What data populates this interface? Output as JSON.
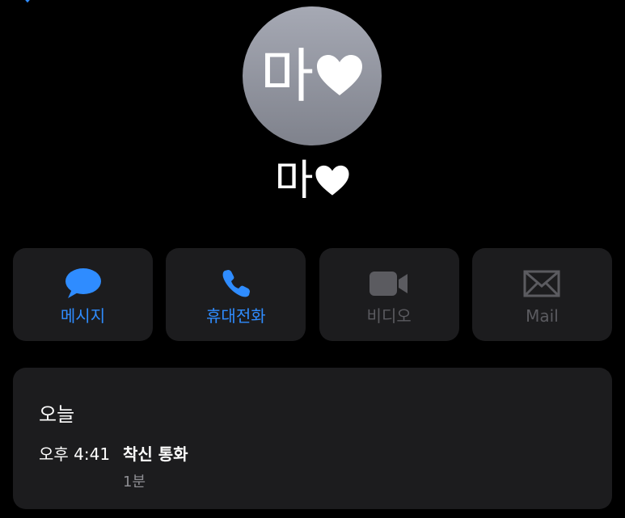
{
  "contact": {
    "avatar_text": "마",
    "avatar_emoji": "heart",
    "name_text": "마",
    "name_emoji": "heart"
  },
  "actions": [
    {
      "label": "메시지",
      "icon": "message-bubble-icon",
      "enabled": true
    },
    {
      "label": "휴대전화",
      "icon": "phone-icon",
      "enabled": true
    },
    {
      "label": "비디오",
      "icon": "video-camera-icon",
      "enabled": false
    },
    {
      "label": "Mail",
      "icon": "mail-envelope-icon",
      "enabled": false
    }
  ],
  "recents": {
    "heading": "오늘",
    "entries": [
      {
        "time": "오후 4:41",
        "type": "착신 통화",
        "duration": "1분"
      }
    ]
  },
  "colors": {
    "background": "#000000",
    "card": "#1c1c1e",
    "accent": "#2f8cff",
    "disabled": "#5b5b60",
    "secondary_text": "#8e8e93",
    "avatar_top": "#a6a9b4",
    "avatar_bottom": "#7f828c"
  }
}
